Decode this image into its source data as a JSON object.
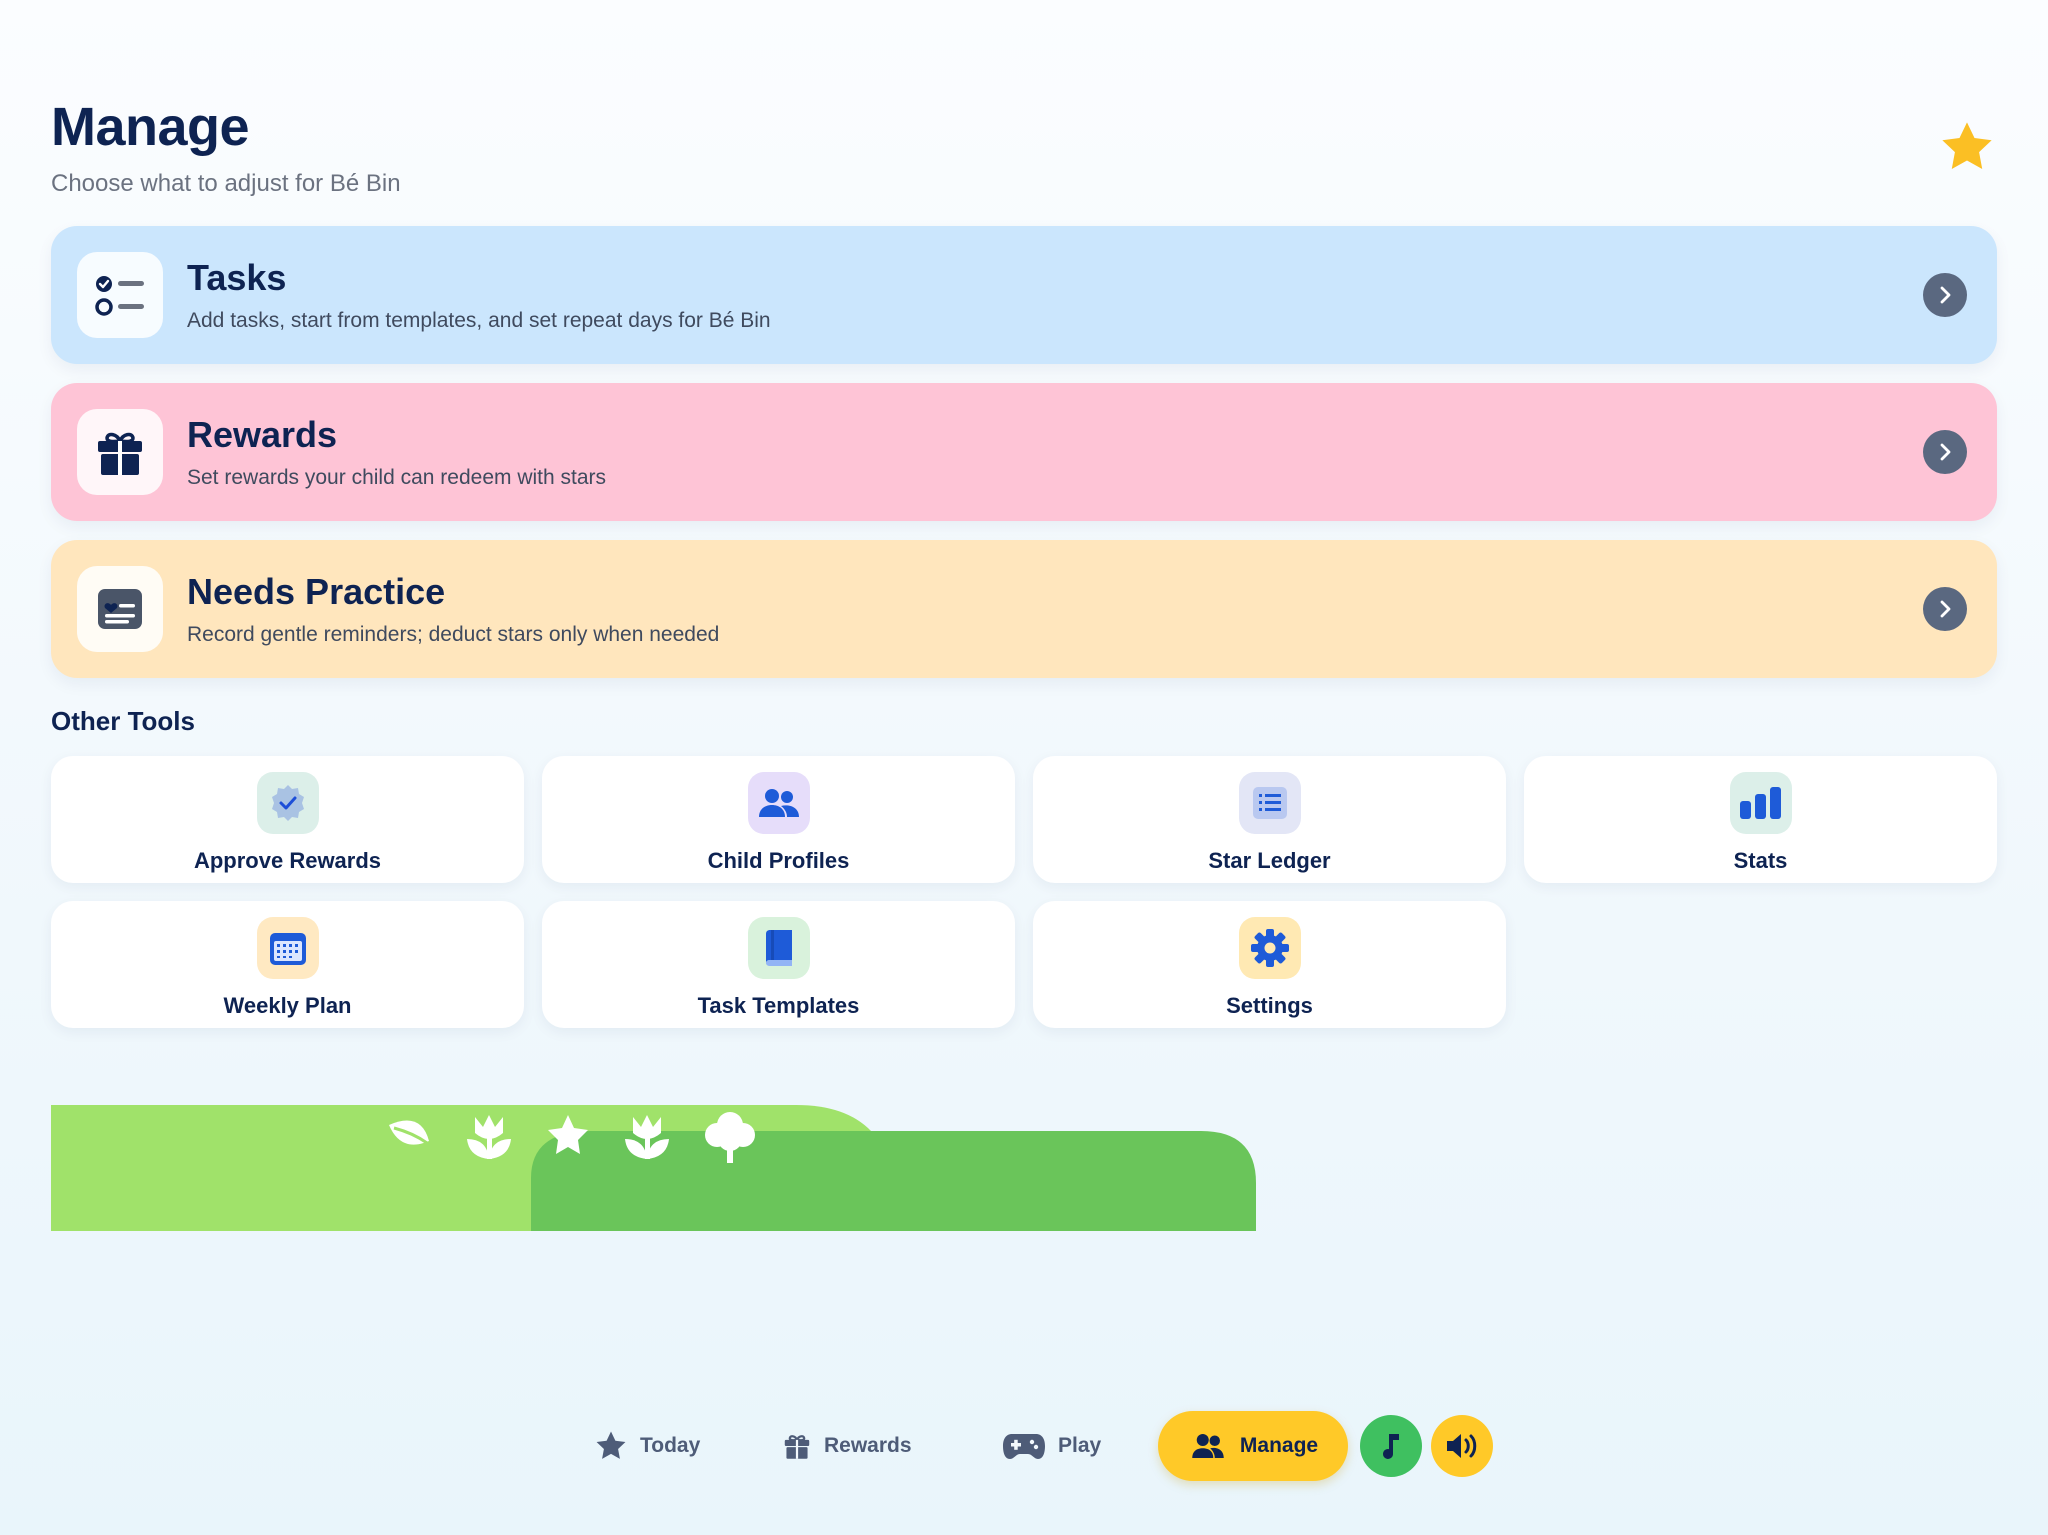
{
  "header": {
    "title": "Manage",
    "subtitle": "Choose what to adjust for Bé Bin",
    "star_icon": "star-icon"
  },
  "cards": [
    {
      "title": "Tasks",
      "description": "Add tasks, start from templates, and set repeat days for Bé Bin",
      "icon": "checklist-icon",
      "color": "#cbe6fd"
    },
    {
      "title": "Rewards",
      "description": "Set rewards your child can redeem with stars",
      "icon": "gift-icon",
      "color": "#fec4d6"
    },
    {
      "title": "Needs Practice",
      "description": "Record gentle reminders; deduct stars only when needed",
      "icon": "heart-note-icon",
      "color": "#ffe6bd"
    }
  ],
  "other_tools": {
    "title": "Other Tools",
    "items": [
      {
        "label": "Approve Rewards",
        "icon": "verified-badge-icon"
      },
      {
        "label": "Child Profiles",
        "icon": "people-icon"
      },
      {
        "label": "Star Ledger",
        "icon": "list-icon"
      },
      {
        "label": "Stats",
        "icon": "bar-chart-icon"
      },
      {
        "label": "Weekly Plan",
        "icon": "calendar-icon"
      },
      {
        "label": "Task Templates",
        "icon": "book-icon"
      },
      {
        "label": "Settings",
        "icon": "gear-icon"
      }
    ]
  },
  "nav": {
    "today": "Today",
    "rewards": "Rewards",
    "play": "Play",
    "manage": "Manage",
    "music_icon": "music-note-icon",
    "sound_icon": "speaker-icon"
  },
  "colors": {
    "primary_text": "#0e2352",
    "accent_yellow": "#ffc928",
    "green": "#3fc060"
  }
}
